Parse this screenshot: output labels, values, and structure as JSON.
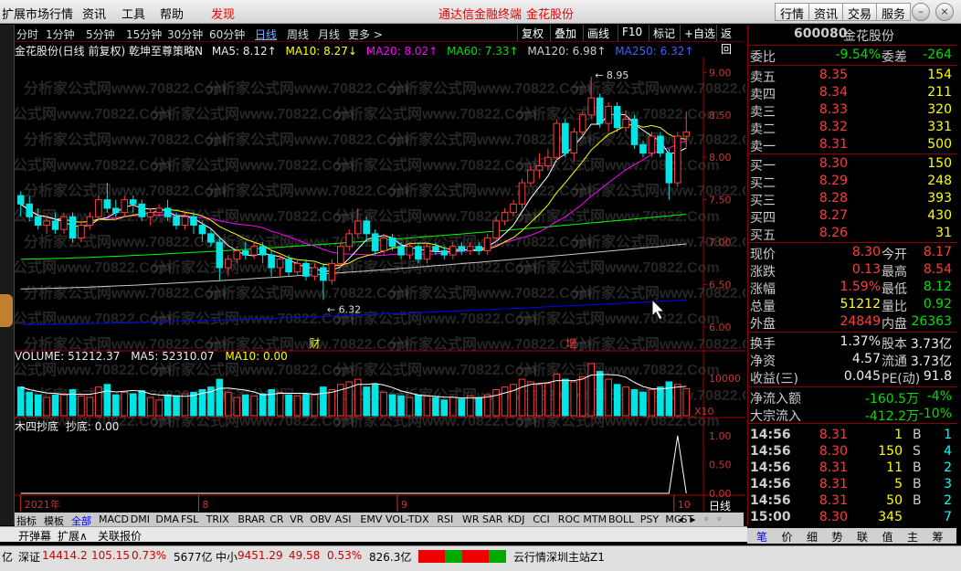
{
  "menubar": {
    "items": [
      "扩展市场行情",
      "资讯",
      "工具",
      "帮助"
    ],
    "discover": "发现",
    "center_title": "通达信金融终端",
    "stock_title": "金花股份",
    "right_buttons": [
      "行情",
      "资讯",
      "交易",
      "服务"
    ]
  },
  "periods": {
    "items": [
      "分时",
      "1分钟",
      "5分钟",
      "15分钟",
      "30分钟",
      "60分钟",
      "日线",
      "周线",
      "月线",
      "更多 >"
    ],
    "active": "日线",
    "tools": [
      "复权",
      "叠加",
      "画线",
      "F10",
      "标记",
      "+自选",
      "返回"
    ]
  },
  "main_info": {
    "title": "金花股份(日线 前复权) 乾坤至尊策略N",
    "ma5": "MA5: 8.12",
    "ma10": "MA10: 8.27",
    "ma20": "MA20: 8.02",
    "ma60": "MA60: 7.33",
    "ma120": "MA120: 6.98",
    "ma250": "MA250: 6.32"
  },
  "chart_data": {
    "type": "candlestick",
    "price_axis": {
      "ticks": [
        "9.00",
        "8.50",
        "8.00",
        "7.50",
        "7.00",
        "6.50",
        "6.00"
      ],
      "ylim": [
        5.85,
        9.1
      ]
    },
    "high_label": "8.95",
    "low_label": "6.32",
    "markers": [
      "财",
      "增"
    ],
    "x_labels": [
      "2021年",
      "8",
      "9",
      "10"
    ],
    "volume_info": {
      "vol": "VOLUME: 51212.37",
      "ma5": "MA5: 52310.07",
      "ma10": "MA10: 0.00"
    },
    "volume_axis": {
      "ticks": [
        "10000"
      ],
      "unit": "X10"
    },
    "indicator_info": {
      "name": "木四抄底",
      "value": "抄底: 0.00"
    },
    "indicator_axis": {
      "ticks": [
        "1.00",
        "0.50",
        "0.00"
      ]
    },
    "candles": [
      [
        7.55,
        7.45,
        7.6,
        7.3
      ],
      [
        7.45,
        7.3,
        7.55,
        7.25
      ],
      [
        7.3,
        7.2,
        7.4,
        7.15
      ],
      [
        7.2,
        7.25,
        7.3,
        7.1
      ],
      [
        7.25,
        7.15,
        7.35,
        7.1
      ],
      [
        7.15,
        7.3,
        7.35,
        7.1
      ],
      [
        7.3,
        7.05,
        7.35,
        7.0
      ],
      [
        7.05,
        7.2,
        7.25,
        7.0
      ],
      [
        7.2,
        7.3,
        7.35,
        7.15
      ],
      [
        7.3,
        7.5,
        7.55,
        7.25
      ],
      [
        7.5,
        7.4,
        7.7,
        7.35
      ],
      [
        7.4,
        7.35,
        7.5,
        7.3
      ],
      [
        7.35,
        7.5,
        7.55,
        7.3
      ],
      [
        7.5,
        7.45,
        7.55,
        7.35
      ],
      [
        7.45,
        7.3,
        7.5,
        7.25
      ],
      [
        7.3,
        7.35,
        7.4,
        7.2
      ],
      [
        7.35,
        7.4,
        7.45,
        7.3
      ],
      [
        7.4,
        7.3,
        7.5,
        7.25
      ],
      [
        7.3,
        7.2,
        7.35,
        7.15
      ],
      [
        7.2,
        7.3,
        7.35,
        7.15
      ],
      [
        7.3,
        7.2,
        7.35,
        7.1
      ],
      [
        7.2,
        7.1,
        7.25,
        7.0
      ],
      [
        7.1,
        7.0,
        7.15,
        6.95
      ],
      [
        7.0,
        6.7,
        7.05,
        6.55
      ],
      [
        6.7,
        6.8,
        6.85,
        6.6
      ],
      [
        6.8,
        6.9,
        6.95,
        6.75
      ],
      [
        6.9,
        6.85,
        7.0,
        6.8
      ],
      [
        6.85,
        6.95,
        7.0,
        6.8
      ],
      [
        6.95,
        6.85,
        7.0,
        6.75
      ],
      [
        6.85,
        6.7,
        6.9,
        6.6
      ],
      [
        6.7,
        6.8,
        6.85,
        6.6
      ],
      [
        6.8,
        6.65,
        6.85,
        6.6
      ],
      [
        6.65,
        6.75,
        6.8,
        6.6
      ],
      [
        6.75,
        6.6,
        6.8,
        6.55
      ],
      [
        6.6,
        6.7,
        6.75,
        6.55
      ],
      [
        6.7,
        6.55,
        6.75,
        6.32
      ],
      [
        6.55,
        6.75,
        6.8,
        6.5
      ],
      [
        6.75,
        6.95,
        7.0,
        6.7
      ],
      [
        6.95,
        7.1,
        7.15,
        6.9
      ],
      [
        7.1,
        7.25,
        7.4,
        7.05
      ],
      [
        7.25,
        7.1,
        7.3,
        7.0
      ],
      [
        7.1,
        6.9,
        7.15,
        6.85
      ],
      [
        6.9,
        7.05,
        7.1,
        6.85
      ],
      [
        7.05,
        6.95,
        7.1,
        6.9
      ],
      [
        6.95,
        6.85,
        7.0,
        6.8
      ],
      [
        6.85,
        6.95,
        7.0,
        6.8
      ],
      [
        6.95,
        6.8,
        7.0,
        6.75
      ],
      [
        6.8,
        6.95,
        7.0,
        6.75
      ],
      [
        6.95,
        6.9,
        7.0,
        6.85
      ],
      [
        6.9,
        6.85,
        6.95,
        6.8
      ],
      [
        6.85,
        6.95,
        7.0,
        6.8
      ],
      [
        6.95,
        6.9,
        7.0,
        6.85
      ],
      [
        6.9,
        6.95,
        7.0,
        6.85
      ],
      [
        6.95,
        6.9,
        7.0,
        6.85
      ],
      [
        6.9,
        7.05,
        7.1,
        6.85
      ],
      [
        7.05,
        7.25,
        7.3,
        7.0
      ],
      [
        7.25,
        7.35,
        7.4,
        7.2
      ],
      [
        7.35,
        7.45,
        7.5,
        7.3
      ],
      [
        7.45,
        7.7,
        7.75,
        7.4
      ],
      [
        7.7,
        7.85,
        7.9,
        7.65
      ],
      [
        7.85,
        7.9,
        8.05,
        7.75
      ],
      [
        7.9,
        8.0,
        8.1,
        7.85
      ],
      [
        8.0,
        8.4,
        8.45,
        7.95
      ],
      [
        8.4,
        8.05,
        8.45,
        8.0
      ],
      [
        8.05,
        8.3,
        8.35,
        7.95
      ],
      [
        8.3,
        8.5,
        8.55,
        8.25
      ],
      [
        8.5,
        8.7,
        8.95,
        8.45
      ],
      [
        8.7,
        8.4,
        8.75,
        8.35
      ],
      [
        8.4,
        8.6,
        8.65,
        8.3
      ],
      [
        8.6,
        8.35,
        8.65,
        8.3
      ],
      [
        8.35,
        8.45,
        8.55,
        8.3
      ],
      [
        8.45,
        8.15,
        8.5,
        8.1
      ],
      [
        8.15,
        8.05,
        8.2,
        8.0
      ],
      [
        8.05,
        8.25,
        8.3,
        8.0
      ],
      [
        8.25,
        8.05,
        8.3,
        8.0
      ],
      [
        8.05,
        7.7,
        8.1,
        7.5
      ],
      [
        7.7,
        8.25,
        8.3,
        7.65
      ],
      [
        8.25,
        8.3,
        8.54,
        8.12
      ]
    ],
    "volumes": [
      0.55,
      0.45,
      0.4,
      0.35,
      0.4,
      0.42,
      0.5,
      0.38,
      0.35,
      0.55,
      0.6,
      0.4,
      0.45,
      0.42,
      0.48,
      0.35,
      0.3,
      0.4,
      0.38,
      0.42,
      0.45,
      0.5,
      0.55,
      0.7,
      0.45,
      0.35,
      0.4,
      0.38,
      0.42,
      0.5,
      0.45,
      0.4,
      0.38,
      0.42,
      0.4,
      0.55,
      0.5,
      0.6,
      0.65,
      0.7,
      0.55,
      0.6,
      0.45,
      0.4,
      0.38,
      0.35,
      0.4,
      0.38,
      0.35,
      0.3,
      0.35,
      0.32,
      0.38,
      0.35,
      0.4,
      0.5,
      0.55,
      0.6,
      0.7,
      0.65,
      0.6,
      0.62,
      0.8,
      0.7,
      0.65,
      0.75,
      1.0,
      0.85,
      0.7,
      0.6,
      0.55,
      0.5,
      0.45,
      0.5,
      0.55,
      0.65,
      0.6,
      0.52
    ],
    "ma_colors": {
      "ma5": "#ffffff",
      "ma10": "#ffff00",
      "ma20": "#ff00ff",
      "ma60": "#00ff00",
      "ma120": "#c8c8c8",
      "ma250": "#0000ff"
    }
  },
  "quote": {
    "code": "600080",
    "name": "金花股份",
    "weibi_label": "委比",
    "weibi": "-9.54%",
    "weicha_label": "委差",
    "weicha": "-264",
    "sells": [
      {
        "label": "卖五",
        "price": "8.35",
        "vol": "154"
      },
      {
        "label": "卖四",
        "price": "8.34",
        "vol": "211"
      },
      {
        "label": "卖三",
        "price": "8.33",
        "vol": "320"
      },
      {
        "label": "卖二",
        "price": "8.32",
        "vol": "331"
      },
      {
        "label": "卖一",
        "price": "8.31",
        "vol": "500"
      }
    ],
    "buys": [
      {
        "label": "买一",
        "price": "8.30",
        "vol": "150"
      },
      {
        "label": "买二",
        "price": "8.29",
        "vol": "248"
      },
      {
        "label": "买三",
        "price": "8.28",
        "vol": "393"
      },
      {
        "label": "买四",
        "price": "8.27",
        "vol": "430"
      },
      {
        "label": "买五",
        "price": "8.26",
        "vol": "31"
      }
    ],
    "stats": [
      {
        "l": "现价",
        "v": "8.30",
        "l2": "今开",
        "v2": "8.17",
        "c": "red",
        "c2": "red"
      },
      {
        "l": "涨跌",
        "v": "0.13",
        "l2": "最高",
        "v2": "8.54",
        "c": "red",
        "c2": "red"
      },
      {
        "l": "涨幅",
        "v": "1.59%",
        "l2": "最低",
        "v2": "8.12",
        "c": "red",
        "c2": "grn"
      },
      {
        "l": "总量",
        "v": "51212",
        "l2": "量比",
        "v2": "0.92",
        "c": "yel",
        "c2": "grn"
      },
      {
        "l": "外盘",
        "v": "24849",
        "l2": "内盘",
        "v2": "26363",
        "c": "red",
        "c2": "grn"
      }
    ],
    "stats2": [
      {
        "l": "换手",
        "v": "1.37%",
        "l2": "股本",
        "v2": "3.73亿"
      },
      {
        "l": "净资",
        "v": "4.57",
        "l2": "流通",
        "v2": "3.73亿"
      },
      {
        "l": "收益(三)",
        "v": "0.045",
        "l2": "PE(动)",
        "v2": "91.8"
      }
    ],
    "flow": [
      {
        "l": "净流入额",
        "v": "-160.5万",
        "p": "-4%"
      },
      {
        "l": "大宗流入",
        "v": "-412.2万",
        "p": "-10%"
      }
    ],
    "ticks": [
      {
        "t": "14:56",
        "p": "8.31",
        "v": "1",
        "s": "B"
      },
      {
        "t": "14:56",
        "p": "8.30",
        "v": "150",
        "s": "S"
      },
      {
        "t": "14:56",
        "p": "8.31",
        "v": "11",
        "s": "B"
      },
      {
        "t": "14:56",
        "p": "8.31",
        "v": "5",
        "s": "B"
      },
      {
        "t": "14:56",
        "p": "8.31",
        "v": "50",
        "s": "B"
      },
      {
        "t": "15:00",
        "p": "8.30",
        "v": "345",
        "s": ""
      }
    ],
    "tick_nums": [
      "1",
      "4",
      "2",
      "3",
      "2",
      "7"
    ]
  },
  "bottom_tabs": {
    "items": [
      "指标",
      "模板",
      "全部",
      "MACD",
      "DMI",
      "DMA",
      "FSL",
      "TRIX",
      "BRAR",
      "CR",
      "VR",
      "OBV",
      "ASI",
      "EMV",
      "VOL-TDX",
      "RSI",
      "WR",
      "SAR",
      "KDJ",
      "CCI",
      "ROC",
      "MTM",
      "BOLL",
      "PSY",
      "MCST"
    ],
    "active": "全部",
    "daily": "日线"
  },
  "bottom2": {
    "items": [
      "开弹幕",
      "扩展∧",
      "关联报价"
    ]
  },
  "right_tabs": {
    "items": [
      "笔",
      "价",
      "细",
      "势",
      "联",
      "值",
      "主",
      "筹"
    ]
  },
  "status": {
    "a": "亿",
    "sz": "深证",
    "sz_val": "14414.2",
    "sz_chg": "105.15",
    "sz_pct": "0.73%",
    "sz_amt": "5677亿",
    "zx": "中小",
    "zx_val": "9451.29",
    "zx_chg": "49.58",
    "zx_pct": "0.53%",
    "zx_amt": "826.3亿",
    "server": "云行情深圳主站Z1"
  },
  "watermark": "分析家公式网www.70822.Com"
}
